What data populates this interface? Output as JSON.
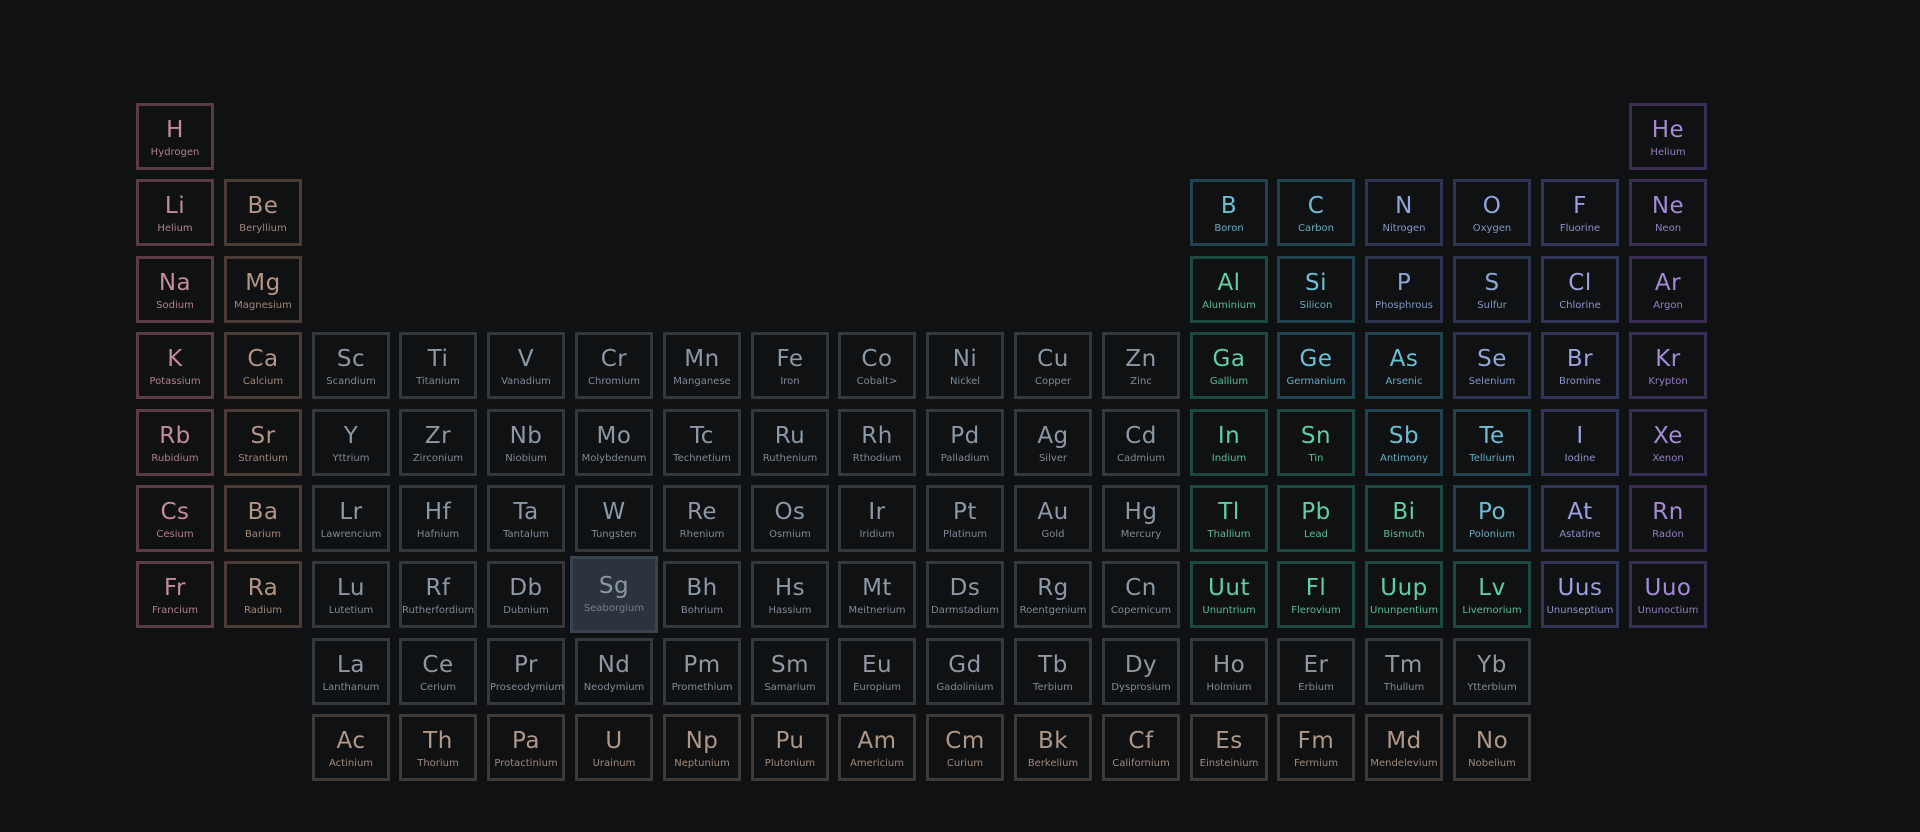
{
  "selected_element": "Sg",
  "category_colors": {
    "alkali": {
      "text": "#c48c9a",
      "border": "#5a3b45"
    },
    "alkaline": {
      "text": "#b49484",
      "border": "#4a3b36"
    },
    "transition": {
      "text": "#8b98a6",
      "border": "#34373b"
    },
    "post_transition": {
      "text": "#5ed0a8",
      "border": "#1d4a3e"
    },
    "metalloid": {
      "text": "#6dbfd6",
      "border": "#1f4450"
    },
    "nonmetal": {
      "text": "#8fa6d8",
      "border": "#2c3550"
    },
    "halogen": {
      "text": "#9aa0e0",
      "border": "#33345a"
    },
    "noble": {
      "text": "#a58ad6",
      "border": "#3a2e55"
    },
    "lanthanide": {
      "text": "#8f98a3",
      "border": "#35383c"
    },
    "actinide": {
      "text": "#b09888",
      "border": "#3f3a36"
    }
  },
  "elements": [
    {
      "sym": "H",
      "name": "Hydrogen",
      "row": 1,
      "col": 1,
      "cat": "alkali"
    },
    {
      "sym": "He",
      "name": "Helium",
      "row": 1,
      "col": 18,
      "cat": "noble"
    },
    {
      "sym": "Li",
      "name": "Helium",
      "row": 2,
      "col": 1,
      "cat": "alkali"
    },
    {
      "sym": "Be",
      "name": "Beryllium",
      "row": 2,
      "col": 2,
      "cat": "alkaline"
    },
    {
      "sym": "B",
      "name": "Boron",
      "row": 2,
      "col": 13,
      "cat": "metalloid"
    },
    {
      "sym": "C",
      "name": "Carbon",
      "row": 2,
      "col": 14,
      "cat": "metalloid"
    },
    {
      "sym": "N",
      "name": "Nitrogen",
      "row": 2,
      "col": 15,
      "cat": "nonmetal"
    },
    {
      "sym": "O",
      "name": "Oxygen",
      "row": 2,
      "col": 16,
      "cat": "nonmetal"
    },
    {
      "sym": "F",
      "name": "Fluorine",
      "row": 2,
      "col": 17,
      "cat": "halogen"
    },
    {
      "sym": "Ne",
      "name": "Neon",
      "row": 2,
      "col": 18,
      "cat": "noble"
    },
    {
      "sym": "Na",
      "name": "Sodium",
      "row": 3,
      "col": 1,
      "cat": "alkali"
    },
    {
      "sym": "Mg",
      "name": "Magnesium",
      "row": 3,
      "col": 2,
      "cat": "alkaline"
    },
    {
      "sym": "Al",
      "name": "Aluminium",
      "row": 3,
      "col": 13,
      "cat": "post_transition"
    },
    {
      "sym": "Si",
      "name": "Silicon",
      "row": 3,
      "col": 14,
      "cat": "metalloid"
    },
    {
      "sym": "P",
      "name": "Phosphrous",
      "row": 3,
      "col": 15,
      "cat": "nonmetal"
    },
    {
      "sym": "S",
      "name": "Sulfur",
      "row": 3,
      "col": 16,
      "cat": "nonmetal"
    },
    {
      "sym": "Cl",
      "name": "Chlorine",
      "row": 3,
      "col": 17,
      "cat": "halogen"
    },
    {
      "sym": "Ar",
      "name": "Argon",
      "row": 3,
      "col": 18,
      "cat": "noble"
    },
    {
      "sym": "K",
      "name": "Potassium",
      "row": 4,
      "col": 1,
      "cat": "alkali"
    },
    {
      "sym": "Ca",
      "name": "Calcium",
      "row": 4,
      "col": 2,
      "cat": "alkaline"
    },
    {
      "sym": "Sc",
      "name": "Scandium",
      "row": 4,
      "col": 3,
      "cat": "transition"
    },
    {
      "sym": "Ti",
      "name": "Titanium",
      "row": 4,
      "col": 4,
      "cat": "transition"
    },
    {
      "sym": "V",
      "name": "Vanadium",
      "row": 4,
      "col": 5,
      "cat": "transition"
    },
    {
      "sym": "Cr",
      "name": "Chromium",
      "row": 4,
      "col": 6,
      "cat": "transition"
    },
    {
      "sym": "Mn",
      "name": "Manganese",
      "row": 4,
      "col": 7,
      "cat": "transition"
    },
    {
      "sym": "Fe",
      "name": "Iron",
      "row": 4,
      "col": 8,
      "cat": "transition"
    },
    {
      "sym": "Co",
      "name": "Cobalt>",
      "row": 4,
      "col": 9,
      "cat": "transition"
    },
    {
      "sym": "Ni",
      "name": "Nickel",
      "row": 4,
      "col": 10,
      "cat": "transition"
    },
    {
      "sym": "Cu",
      "name": "Copper",
      "row": 4,
      "col": 11,
      "cat": "transition"
    },
    {
      "sym": "Zn",
      "name": "Zinc",
      "row": 4,
      "col": 12,
      "cat": "transition"
    },
    {
      "sym": "Ga",
      "name": "Gallium",
      "row": 4,
      "col": 13,
      "cat": "post_transition"
    },
    {
      "sym": "Ge",
      "name": "Germanium",
      "row": 4,
      "col": 14,
      "cat": "metalloid"
    },
    {
      "sym": "As",
      "name": "Arsenic",
      "row": 4,
      "col": 15,
      "cat": "metalloid"
    },
    {
      "sym": "Se",
      "name": "Selenium",
      "row": 4,
      "col": 16,
      "cat": "nonmetal"
    },
    {
      "sym": "Br",
      "name": "Bromine",
      "row": 4,
      "col": 17,
      "cat": "halogen"
    },
    {
      "sym": "Kr",
      "name": "Krypton",
      "row": 4,
      "col": 18,
      "cat": "noble"
    },
    {
      "sym": "Rb",
      "name": "Rubidium",
      "row": 5,
      "col": 1,
      "cat": "alkali"
    },
    {
      "sym": "Sr",
      "name": "Strantium",
      "row": 5,
      "col": 2,
      "cat": "alkaline"
    },
    {
      "sym": "Y",
      "name": "Yttrium",
      "row": 5,
      "col": 3,
      "cat": "transition"
    },
    {
      "sym": "Zr",
      "name": "Zirconium",
      "row": 5,
      "col": 4,
      "cat": "transition"
    },
    {
      "sym": "Nb",
      "name": "Niobium",
      "row": 5,
      "col": 5,
      "cat": "transition"
    },
    {
      "sym": "Mo",
      "name": "Molybdenum",
      "row": 5,
      "col": 6,
      "cat": "transition"
    },
    {
      "sym": "Tc",
      "name": "Technetium",
      "row": 5,
      "col": 7,
      "cat": "transition"
    },
    {
      "sym": "Ru",
      "name": "Ruthenium",
      "row": 5,
      "col": 8,
      "cat": "transition"
    },
    {
      "sym": "Rh",
      "name": "Rthodium",
      "row": 5,
      "col": 9,
      "cat": "transition"
    },
    {
      "sym": "Pd",
      "name": "Palladium",
      "row": 5,
      "col": 10,
      "cat": "transition"
    },
    {
      "sym": "Ag",
      "name": "Silver",
      "row": 5,
      "col": 11,
      "cat": "transition"
    },
    {
      "sym": "Cd",
      "name": "Cadmium",
      "row": 5,
      "col": 12,
      "cat": "transition"
    },
    {
      "sym": "In",
      "name": "Indium",
      "row": 5,
      "col": 13,
      "cat": "post_transition"
    },
    {
      "sym": "Sn",
      "name": "Tin",
      "row": 5,
      "col": 14,
      "cat": "post_transition"
    },
    {
      "sym": "Sb",
      "name": "Antimony",
      "row": 5,
      "col": 15,
      "cat": "metalloid"
    },
    {
      "sym": "Te",
      "name": "Tellurium",
      "row": 5,
      "col": 16,
      "cat": "metalloid"
    },
    {
      "sym": "I",
      "name": "Iodine",
      "row": 5,
      "col": 17,
      "cat": "halogen"
    },
    {
      "sym": "Xe",
      "name": "Xenon",
      "row": 5,
      "col": 18,
      "cat": "noble"
    },
    {
      "sym": "Cs",
      "name": "Cesium",
      "row": 6,
      "col": 1,
      "cat": "alkali"
    },
    {
      "sym": "Ba",
      "name": "Barium",
      "row": 6,
      "col": 2,
      "cat": "alkaline"
    },
    {
      "sym": "Lr",
      "name": "Lawrencium",
      "row": 6,
      "col": 3,
      "cat": "transition"
    },
    {
      "sym": "Hf",
      "name": "Hafnium",
      "row": 6,
      "col": 4,
      "cat": "transition"
    },
    {
      "sym": "Ta",
      "name": "Tantalum",
      "row": 6,
      "col": 5,
      "cat": "transition"
    },
    {
      "sym": "W",
      "name": "Tungsten",
      "row": 6,
      "col": 6,
      "cat": "transition"
    },
    {
      "sym": "Re",
      "name": "Rhenium",
      "row": 6,
      "col": 7,
      "cat": "transition"
    },
    {
      "sym": "Os",
      "name": "Osmium",
      "row": 6,
      "col": 8,
      "cat": "transition"
    },
    {
      "sym": "Ir",
      "name": "Iridium",
      "row": 6,
      "col": 9,
      "cat": "transition"
    },
    {
      "sym": "Pt",
      "name": "Platinum",
      "row": 6,
      "col": 10,
      "cat": "transition"
    },
    {
      "sym": "Au",
      "name": "Gold",
      "row": 6,
      "col": 11,
      "cat": "transition"
    },
    {
      "sym": "Hg",
      "name": "Mercury",
      "row": 6,
      "col": 12,
      "cat": "transition"
    },
    {
      "sym": "Tl",
      "name": "Thallium",
      "row": 6,
      "col": 13,
      "cat": "post_transition"
    },
    {
      "sym": "Pb",
      "name": "Lead",
      "row": 6,
      "col": 14,
      "cat": "post_transition"
    },
    {
      "sym": "Bi",
      "name": "Bismuth",
      "row": 6,
      "col": 15,
      "cat": "post_transition"
    },
    {
      "sym": "Po",
      "name": "Polonium",
      "row": 6,
      "col": 16,
      "cat": "metalloid"
    },
    {
      "sym": "At",
      "name": "Astatine",
      "row": 6,
      "col": 17,
      "cat": "halogen"
    },
    {
      "sym": "Rn",
      "name": "Radon",
      "row": 6,
      "col": 18,
      "cat": "noble"
    },
    {
      "sym": "Fr",
      "name": "Francium",
      "row": 7,
      "col": 1,
      "cat": "alkali"
    },
    {
      "sym": "Ra",
      "name": "Radium",
      "row": 7,
      "col": 2,
      "cat": "alkaline"
    },
    {
      "sym": "Lu",
      "name": "Lutetium",
      "row": 7,
      "col": 3,
      "cat": "transition"
    },
    {
      "sym": "Rf",
      "name": "Rutherfordium",
      "row": 7,
      "col": 4,
      "cat": "transition"
    },
    {
      "sym": "Db",
      "name": "Dubnium",
      "row": 7,
      "col": 5,
      "cat": "transition"
    },
    {
      "sym": "Sg",
      "name": "Seaborgium",
      "row": 7,
      "col": 6,
      "cat": "transition"
    },
    {
      "sym": "Bh",
      "name": "Bohrium",
      "row": 7,
      "col": 7,
      "cat": "transition"
    },
    {
      "sym": "Hs",
      "name": "Hassium",
      "row": 7,
      "col": 8,
      "cat": "transition"
    },
    {
      "sym": "Mt",
      "name": "Meitnerium",
      "row": 7,
      "col": 9,
      "cat": "transition"
    },
    {
      "sym": "Ds",
      "name": "Darmstadium",
      "row": 7,
      "col": 10,
      "cat": "transition"
    },
    {
      "sym": "Rg",
      "name": "Roentgenium",
      "row": 7,
      "col": 11,
      "cat": "transition"
    },
    {
      "sym": "Cn",
      "name": "Copernicum",
      "row": 7,
      "col": 12,
      "cat": "transition"
    },
    {
      "sym": "Uut",
      "name": "Ununtrium",
      "row": 7,
      "col": 13,
      "cat": "post_transition"
    },
    {
      "sym": "Fl",
      "name": "Flerovium",
      "row": 7,
      "col": 14,
      "cat": "post_transition"
    },
    {
      "sym": "Uup",
      "name": "Ununpentium",
      "row": 7,
      "col": 15,
      "cat": "post_transition"
    },
    {
      "sym": "Lv",
      "name": "Livemorium",
      "row": 7,
      "col": 16,
      "cat": "post_transition"
    },
    {
      "sym": "Uus",
      "name": "Ununseptium",
      "row": 7,
      "col": 17,
      "cat": "halogen"
    },
    {
      "sym": "Uuo",
      "name": "Ununoctium",
      "row": 7,
      "col": 18,
      "cat": "noble"
    },
    {
      "sym": "La",
      "name": "Lanthanum",
      "row": 8,
      "col": 3,
      "cat": "lanthanide"
    },
    {
      "sym": "Ce",
      "name": "Cerium",
      "row": 8,
      "col": 4,
      "cat": "lanthanide"
    },
    {
      "sym": "Pr",
      "name": "Proseodymium",
      "row": 8,
      "col": 5,
      "cat": "lanthanide"
    },
    {
      "sym": "Nd",
      "name": "Neodymium",
      "row": 8,
      "col": 6,
      "cat": "lanthanide"
    },
    {
      "sym": "Pm",
      "name": "Promethium",
      "row": 8,
      "col": 7,
      "cat": "lanthanide"
    },
    {
      "sym": "Sm",
      "name": "Samarium",
      "row": 8,
      "col": 8,
      "cat": "lanthanide"
    },
    {
      "sym": "Eu",
      "name": "Europium",
      "row": 8,
      "col": 9,
      "cat": "lanthanide"
    },
    {
      "sym": "Gd",
      "name": "Gadolinium",
      "row": 8,
      "col": 10,
      "cat": "lanthanide"
    },
    {
      "sym": "Tb",
      "name": "Terbium",
      "row": 8,
      "col": 11,
      "cat": "lanthanide"
    },
    {
      "sym": "Dy",
      "name": "Dysprosium",
      "row": 8,
      "col": 12,
      "cat": "lanthanide"
    },
    {
      "sym": "Ho",
      "name": "Holmium",
      "row": 8,
      "col": 13,
      "cat": "lanthanide"
    },
    {
      "sym": "Er",
      "name": "Erbium",
      "row": 8,
      "col": 14,
      "cat": "lanthanide"
    },
    {
      "sym": "Tm",
      "name": "Thullum",
      "row": 8,
      "col": 15,
      "cat": "lanthanide"
    },
    {
      "sym": "Yb",
      "name": "Ytterbium",
      "row": 8,
      "col": 16,
      "cat": "lanthanide"
    },
    {
      "sym": "Ac",
      "name": "Actinium",
      "row": 9,
      "col": 3,
      "cat": "actinide"
    },
    {
      "sym": "Th",
      "name": "Thorium",
      "row": 9,
      "col": 4,
      "cat": "actinide"
    },
    {
      "sym": "Pa",
      "name": "Protactinium",
      "row": 9,
      "col": 5,
      "cat": "actinide"
    },
    {
      "sym": "U",
      "name": "Urainum",
      "row": 9,
      "col": 6,
      "cat": "actinide"
    },
    {
      "sym": "Np",
      "name": "Neptunium",
      "row": 9,
      "col": 7,
      "cat": "actinide"
    },
    {
      "sym": "Pu",
      "name": "Plutonium",
      "row": 9,
      "col": 8,
      "cat": "actinide"
    },
    {
      "sym": "Am",
      "name": "Americium",
      "row": 9,
      "col": 9,
      "cat": "actinide"
    },
    {
      "sym": "Cm",
      "name": "Curium",
      "row": 9,
      "col": 10,
      "cat": "actinide"
    },
    {
      "sym": "Bk",
      "name": "Berkelium",
      "row": 9,
      "col": 11,
      "cat": "actinide"
    },
    {
      "sym": "Cf",
      "name": "Californium",
      "row": 9,
      "col": 12,
      "cat": "actinide"
    },
    {
      "sym": "Es",
      "name": "Einsteinium",
      "row": 9,
      "col": 13,
      "cat": "actinide"
    },
    {
      "sym": "Fm",
      "name": "Fermium",
      "row": 9,
      "col": 14,
      "cat": "actinide"
    },
    {
      "sym": "Md",
      "name": "Mendelevium",
      "row": 9,
      "col": 15,
      "cat": "actinide"
    },
    {
      "sym": "No",
      "name": "Nobelium",
      "row": 9,
      "col": 16,
      "cat": "actinide"
    }
  ]
}
